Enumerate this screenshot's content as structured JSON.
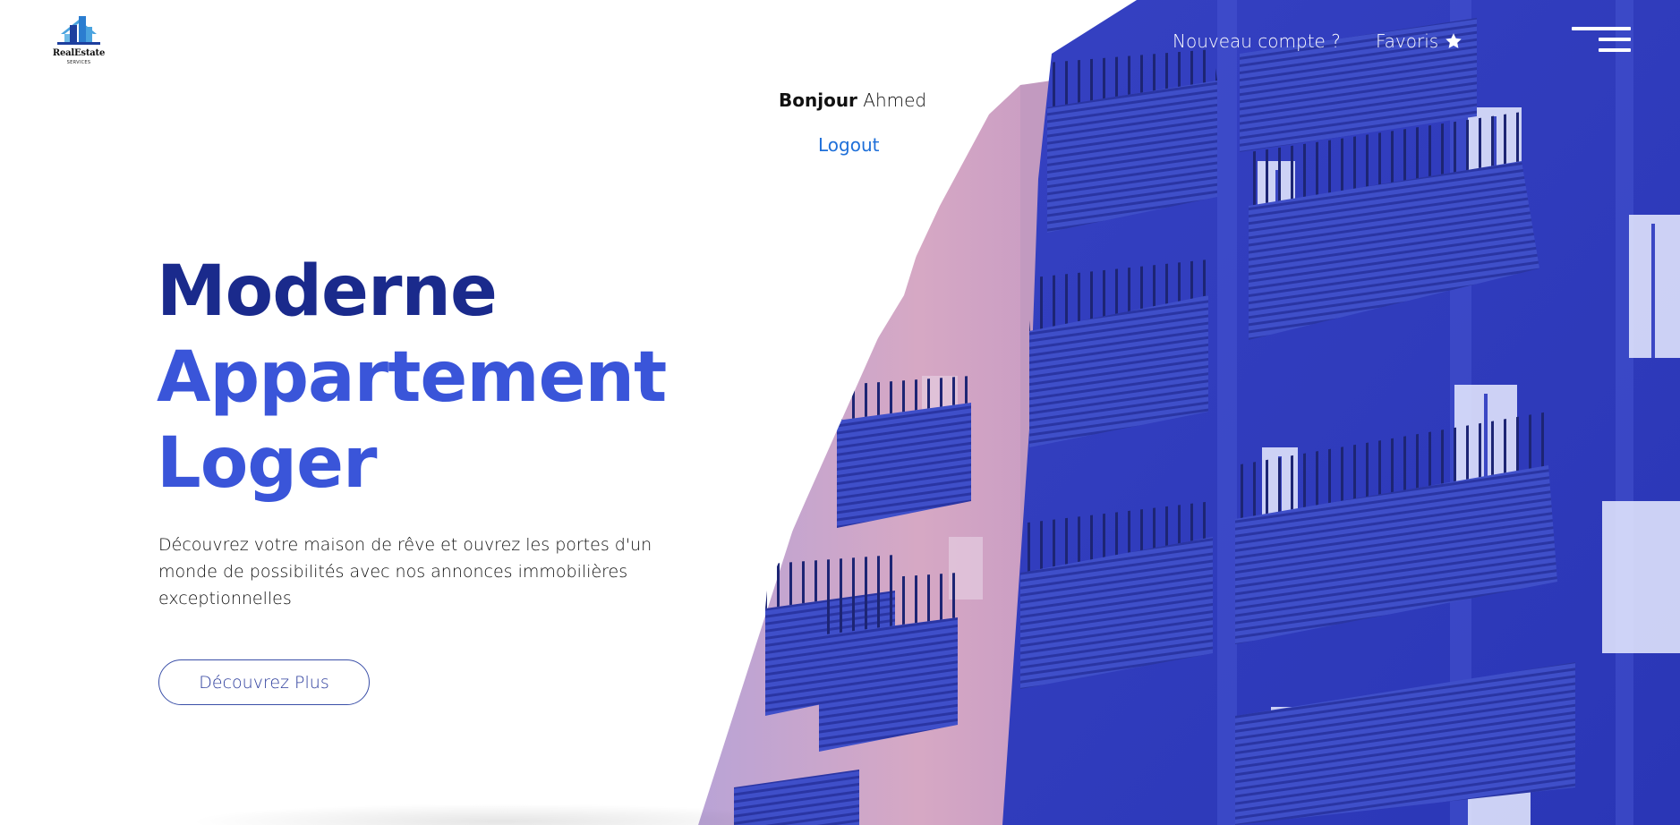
{
  "brand": {
    "name": "RealEstate",
    "tagline": "SERVICES",
    "logo_icon": "building-house-icon",
    "colors": {
      "primary_dark": "#1a2a8c",
      "primary": "#3a55d9",
      "link": "#1e6fd9",
      "overlay": "#2b36b8"
    }
  },
  "nav": {
    "new_account": "Nouveau compte ?",
    "favorites": "Favoris",
    "favorites_icon": "star-icon",
    "menu_icon": "hamburger-menu-icon"
  },
  "user": {
    "greeting_bold": "Bonjour",
    "name": "Ahmed",
    "logout": "Logout"
  },
  "hero": {
    "line1": "Moderne",
    "line2": "Appartement",
    "line3": "Loger",
    "description": "Découvrez votre maison de rêve et ouvrez les portes d'un monde de possibilités avec nos annonces immobilières exceptionnelles",
    "cta": "Découvrez Plus"
  }
}
